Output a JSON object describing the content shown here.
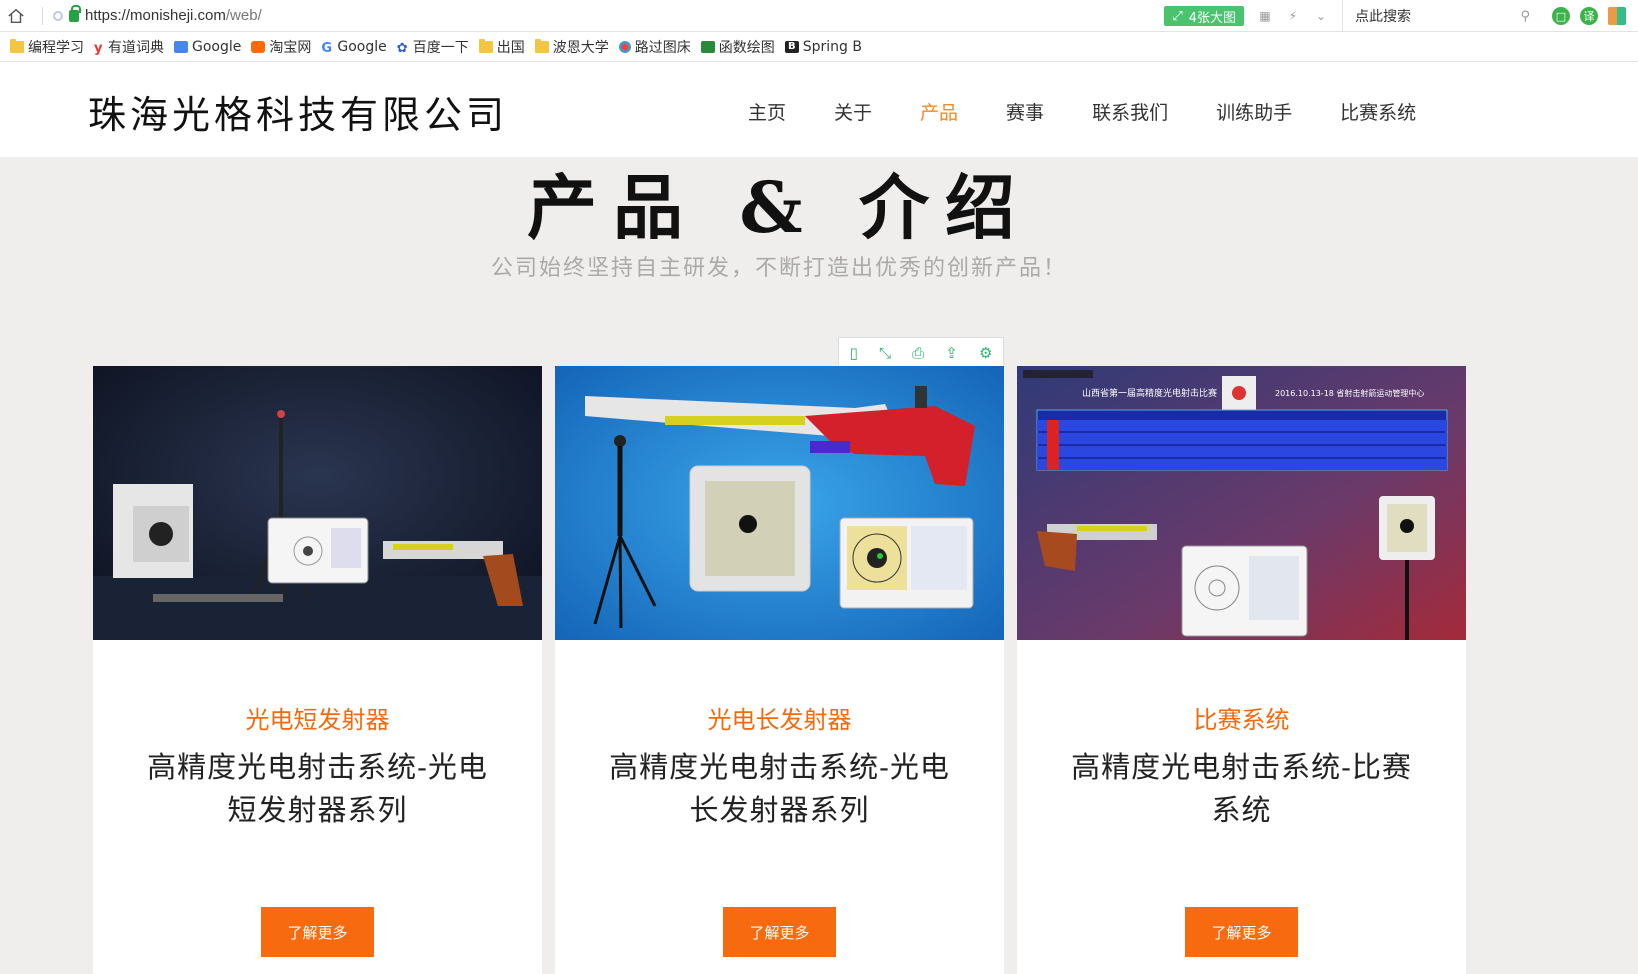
{
  "browser": {
    "url_scheme_host": "https://monisheji.com",
    "url_path": "/web/",
    "big_image_label": "4张大图",
    "search_placeholder": "点此搜索",
    "bookmarks": [
      {
        "label": "编程学习",
        "icon": "folder-icon"
      },
      {
        "label": "有道词典",
        "icon": "youdao-icon"
      },
      {
        "label": "Google",
        "icon": "google-translate-icon"
      },
      {
        "label": "淘宝网",
        "icon": "taobao-icon"
      },
      {
        "label": "Google",
        "icon": "google-icon"
      },
      {
        "label": "百度一下",
        "icon": "baidu-icon"
      },
      {
        "label": "出国",
        "icon": "folder-icon"
      },
      {
        "label": "波恩大学",
        "icon": "folder-icon"
      },
      {
        "label": "路过图床",
        "icon": "imagehost-icon"
      },
      {
        "label": "函数绘图",
        "icon": "graph-icon"
      },
      {
        "label": "Spring B",
        "icon": "bold-b-icon"
      }
    ]
  },
  "site": {
    "logo": "珠海光格科技有限公司",
    "nav": [
      "主页",
      "关于",
      "产品",
      "赛事",
      "联系我们",
      "训练助手",
      "比赛系统"
    ],
    "active_nav": "产品",
    "accent": "#f86a0f"
  },
  "section": {
    "title": "产品 & 介绍",
    "subtitle": "公司始终坚持自主研发，不断打造出优秀的创新产品！"
  },
  "products": [
    {
      "category": "光电短发射器",
      "title": "高精度光电射击系统-光电短发射器系列",
      "button": "了解更多"
    },
    {
      "category": "光电长发射器",
      "title": "高精度光电射击系统-光电长发射器系列",
      "button": "了解更多"
    },
    {
      "category": "比赛系统",
      "title": "高精度光电射击系统-比赛系统",
      "button": "了解更多"
    }
  ],
  "scoreboard": {
    "title": "山西省第一届高精度光电射击比赛",
    "date": "2016.10.13-18 省射击射箭运动管理中心"
  }
}
